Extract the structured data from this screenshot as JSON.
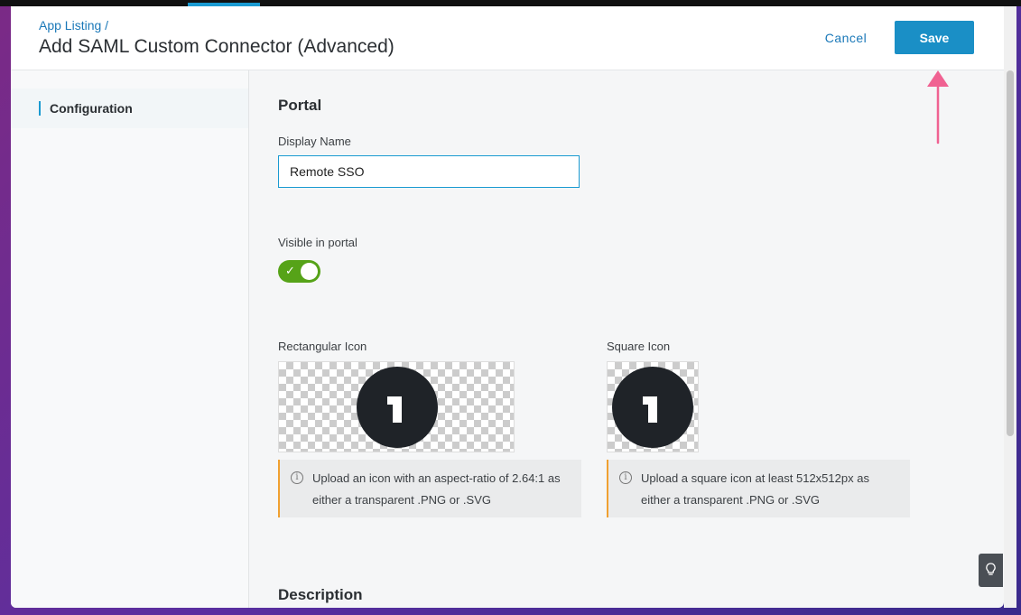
{
  "header": {
    "breadcrumb": "App Listing /",
    "title": "Add SAML Custom Connector (Advanced)",
    "cancel_label": "Cancel",
    "save_label": "Save"
  },
  "sidebar": {
    "items": [
      {
        "label": "Configuration",
        "active": true
      }
    ]
  },
  "portal": {
    "section_title": "Portal",
    "display_name_label": "Display Name",
    "display_name_value": "Remote SSO",
    "visible_label": "Visible in portal",
    "visible_enabled": true,
    "rect_icon_label": "Rectangular Icon",
    "square_icon_label": "Square Icon",
    "rect_icon_hint_line1": "Upload an icon with an aspect-ratio of 2.64:1 as",
    "rect_icon_hint_line2": "either a transparent .PNG or .SVG",
    "square_icon_hint_line1": "Upload a square icon at least 512x512px as",
    "square_icon_hint_line2": "either a transparent .PNG or .SVG"
  },
  "description": {
    "section_title": "Description"
  },
  "icons": {
    "info": "info-icon",
    "check": "check-icon",
    "lightbulb": "lightbulb-icon",
    "arrow": "arrow-up-icon",
    "logo": "onelogin-logo-icon"
  },
  "colors": {
    "accent": "#1a8fc6",
    "toggle_on": "#56a318",
    "warning_border": "#f0a030",
    "annotation_arrow": "#f06292"
  }
}
